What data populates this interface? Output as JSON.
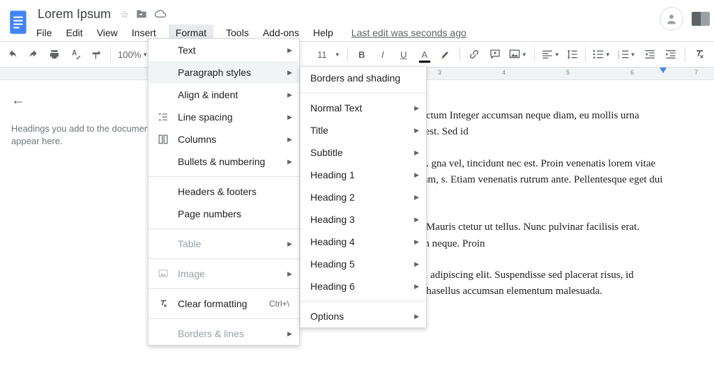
{
  "doc": {
    "title": "Lorem Ipsum",
    "last_edit": "Last edit was seconds ago"
  },
  "menubar": {
    "file": "File",
    "edit": "Edit",
    "view": "View",
    "insert": "Insert",
    "format": "Format",
    "tools": "Tools",
    "addons": "Add-ons",
    "help": "Help"
  },
  "toolbar": {
    "zoom": "100%",
    "font_size": "11"
  },
  "ruler": {
    "t3": "3",
    "t4": "4",
    "t5": "5",
    "t6": "6",
    "t7": "7"
  },
  "outline": {
    "msg1": "Headings you add to the documen",
    "msg2": "appear here."
  },
  "format_menu": {
    "text": "Text",
    "paragraph_styles": "Paragraph styles",
    "align_indent": "Align & indent",
    "line_spacing": "Line spacing",
    "columns": "Columns",
    "bullets_numbering": "Bullets & numbering",
    "headers_footers": "Headers & footers",
    "page_numbers": "Page numbers",
    "table": "Table",
    "image": "Image",
    "clear_formatting": "Clear formatting",
    "clear_shortcut": "Ctrl+\\",
    "borders_lines": "Borders & lines"
  },
  "para_submenu": {
    "borders_shading": "Borders and shading",
    "normal": "Normal Text",
    "title": "Title",
    "subtitle": "Subtitle",
    "h1": "Heading 1",
    "h2": "Heading 2",
    "h3": "Heading 3",
    "h4": "Heading 4",
    "h5": "Heading 5",
    "h6": "Heading 6",
    "options": "Options"
  },
  "body": {
    "p1": "dipiscing elit. Donec a est mauris. Suspendisse dictum Integer accumsan neque diam, eu mollis urna ornare id fermentum tellus. Donec faucibus urna est. Sed id",
    "p2": "ndimentum id dui. Pellentesque nec maximus dui. gna vel, tincidunt nec est. Proin venenatis lorem vitae massa ut mattis condimentum. Nullam lectus ipsum, s. Etiam venenatis rutrum ante. Pellentesque eget dui elit.",
    "p3": "laoreet. Nulla imperdiet vestibulum ullamcorper. Mauris ctetur ut tellus. Nunc pulvinar facilisis erat. Quisque eu ipsum iaculis, auctor urna non, rutrum neque. Proin",
    "p4": "ros facilisis eleifend. Lorem ipsum dolor sit amet, adipiscing elit. Suspendisse sed placerat risus, id dapibus nisi. Suspendisse nec dui non it cursus. Phasellus accumsan elementum malesuada."
  }
}
